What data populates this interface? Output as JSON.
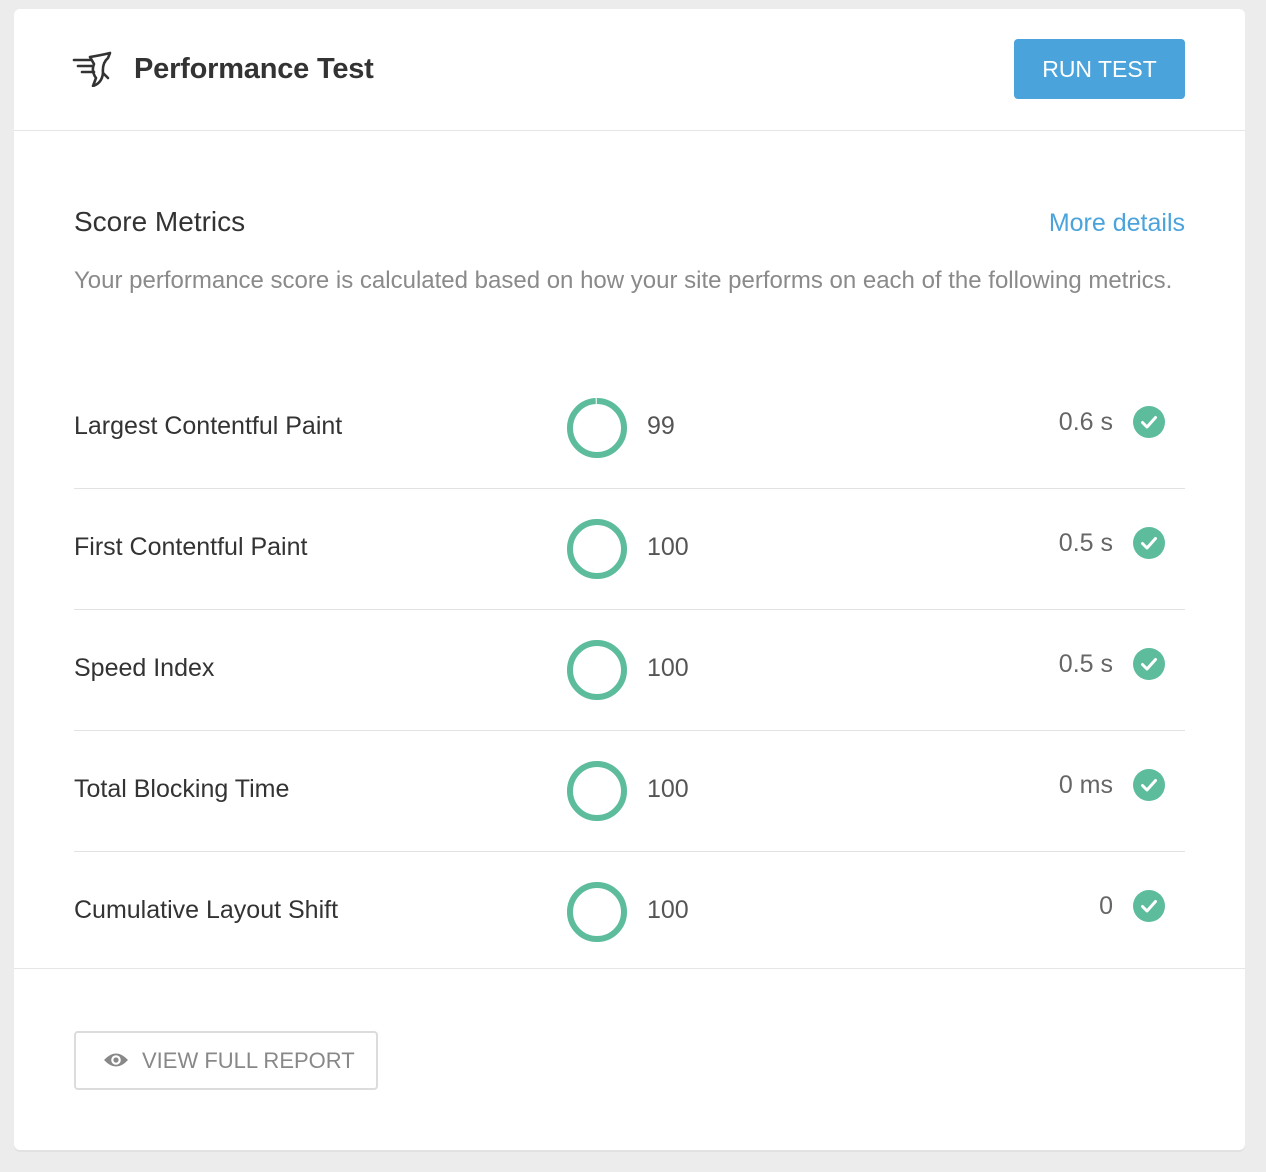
{
  "header": {
    "icon": "hummingbird-icon",
    "title": "Performance Test",
    "run_test_label": "RUN TEST"
  },
  "score_metrics": {
    "title": "Score Metrics",
    "more_details_label": "More details",
    "description": "Your performance score is calculated based on how your site performs on each of the following metrics."
  },
  "metrics": [
    {
      "name": "Largest Contentful Paint",
      "score": "99",
      "score_fraction": 0.99,
      "value": "0.6 s",
      "status": "check-icon"
    },
    {
      "name": "First Contentful Paint",
      "score": "100",
      "score_fraction": 1.0,
      "value": "0.5 s",
      "status": "check-icon"
    },
    {
      "name": "Speed Index",
      "score": "100",
      "score_fraction": 1.0,
      "value": "0.5 s",
      "status": "check-icon"
    },
    {
      "name": "Total Blocking Time",
      "score": "100",
      "score_fraction": 1.0,
      "value": "0 ms",
      "status": "check-icon"
    },
    {
      "name": "Cumulative Layout Shift",
      "score": "100",
      "score_fraction": 1.0,
      "value": "0",
      "status": "check-icon"
    }
  ],
  "footer": {
    "view_full_report_label": "VIEW FULL REPORT",
    "icon": "eye-icon"
  },
  "colors": {
    "accent_blue": "#4ba3dc",
    "success_green": "#5cbc9b",
    "ring_track": "#d7efe7",
    "title_text": "#333333",
    "muted_text": "#8a8a8a"
  }
}
